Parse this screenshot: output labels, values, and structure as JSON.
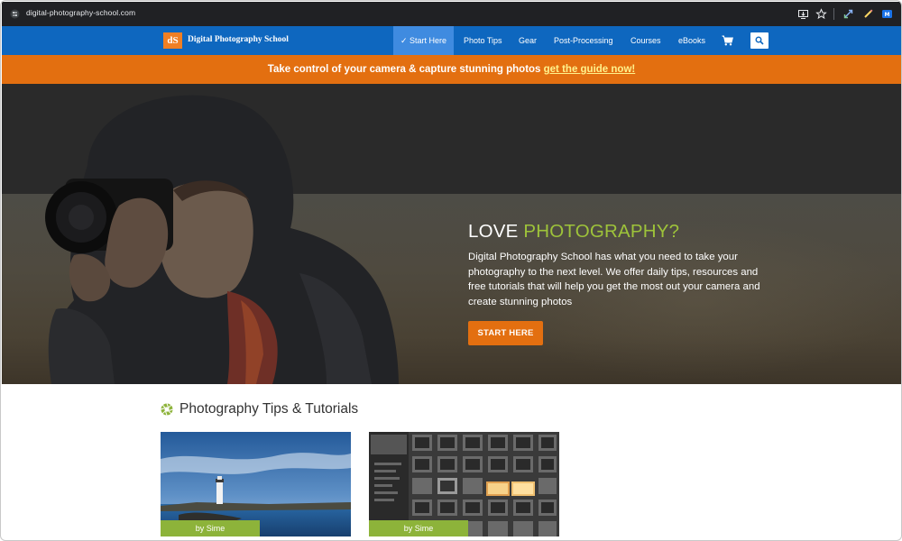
{
  "browser": {
    "url": "digital-photography-school.com",
    "icons": [
      "site-info-icon",
      "install-app-icon",
      "bookmark-star-icon",
      "extension-link-icon",
      "extension-pen-icon",
      "extension-m-icon"
    ]
  },
  "nav": {
    "logo_mark": "dS",
    "logo_text": "Digital Photography School",
    "items": [
      {
        "label": "✓ Start Here",
        "active": true
      },
      {
        "label": "Photo Tips"
      },
      {
        "label": "Gear"
      },
      {
        "label": "Post-Processing"
      },
      {
        "label": "Courses"
      },
      {
        "label": "eBooks"
      }
    ],
    "cart_icon": "cart-icon",
    "search_icon": "search-icon"
  },
  "promo": {
    "text": "Take control of your camera & capture stunning photos ",
    "link": "get the guide now!"
  },
  "hero": {
    "title_plain": "LOVE ",
    "title_highlight": "PHOTOGRAPHY?",
    "body": "Digital Photography School has what you need to take your photography to the next level. We offer daily tips, resources and free tutorials that will help you get the most out your camera and create stunning photos",
    "button": "START HERE"
  },
  "tips": {
    "title": "Photography Tips & Tutorials",
    "cards": [
      {
        "author": "by Sime"
      },
      {
        "author": "by Sime"
      }
    ]
  },
  "colors": {
    "nav_blue": "#0e67bf",
    "orange": "#e36f10",
    "accent_green": "#9ec33a",
    "tag_green": "#8db33a"
  }
}
